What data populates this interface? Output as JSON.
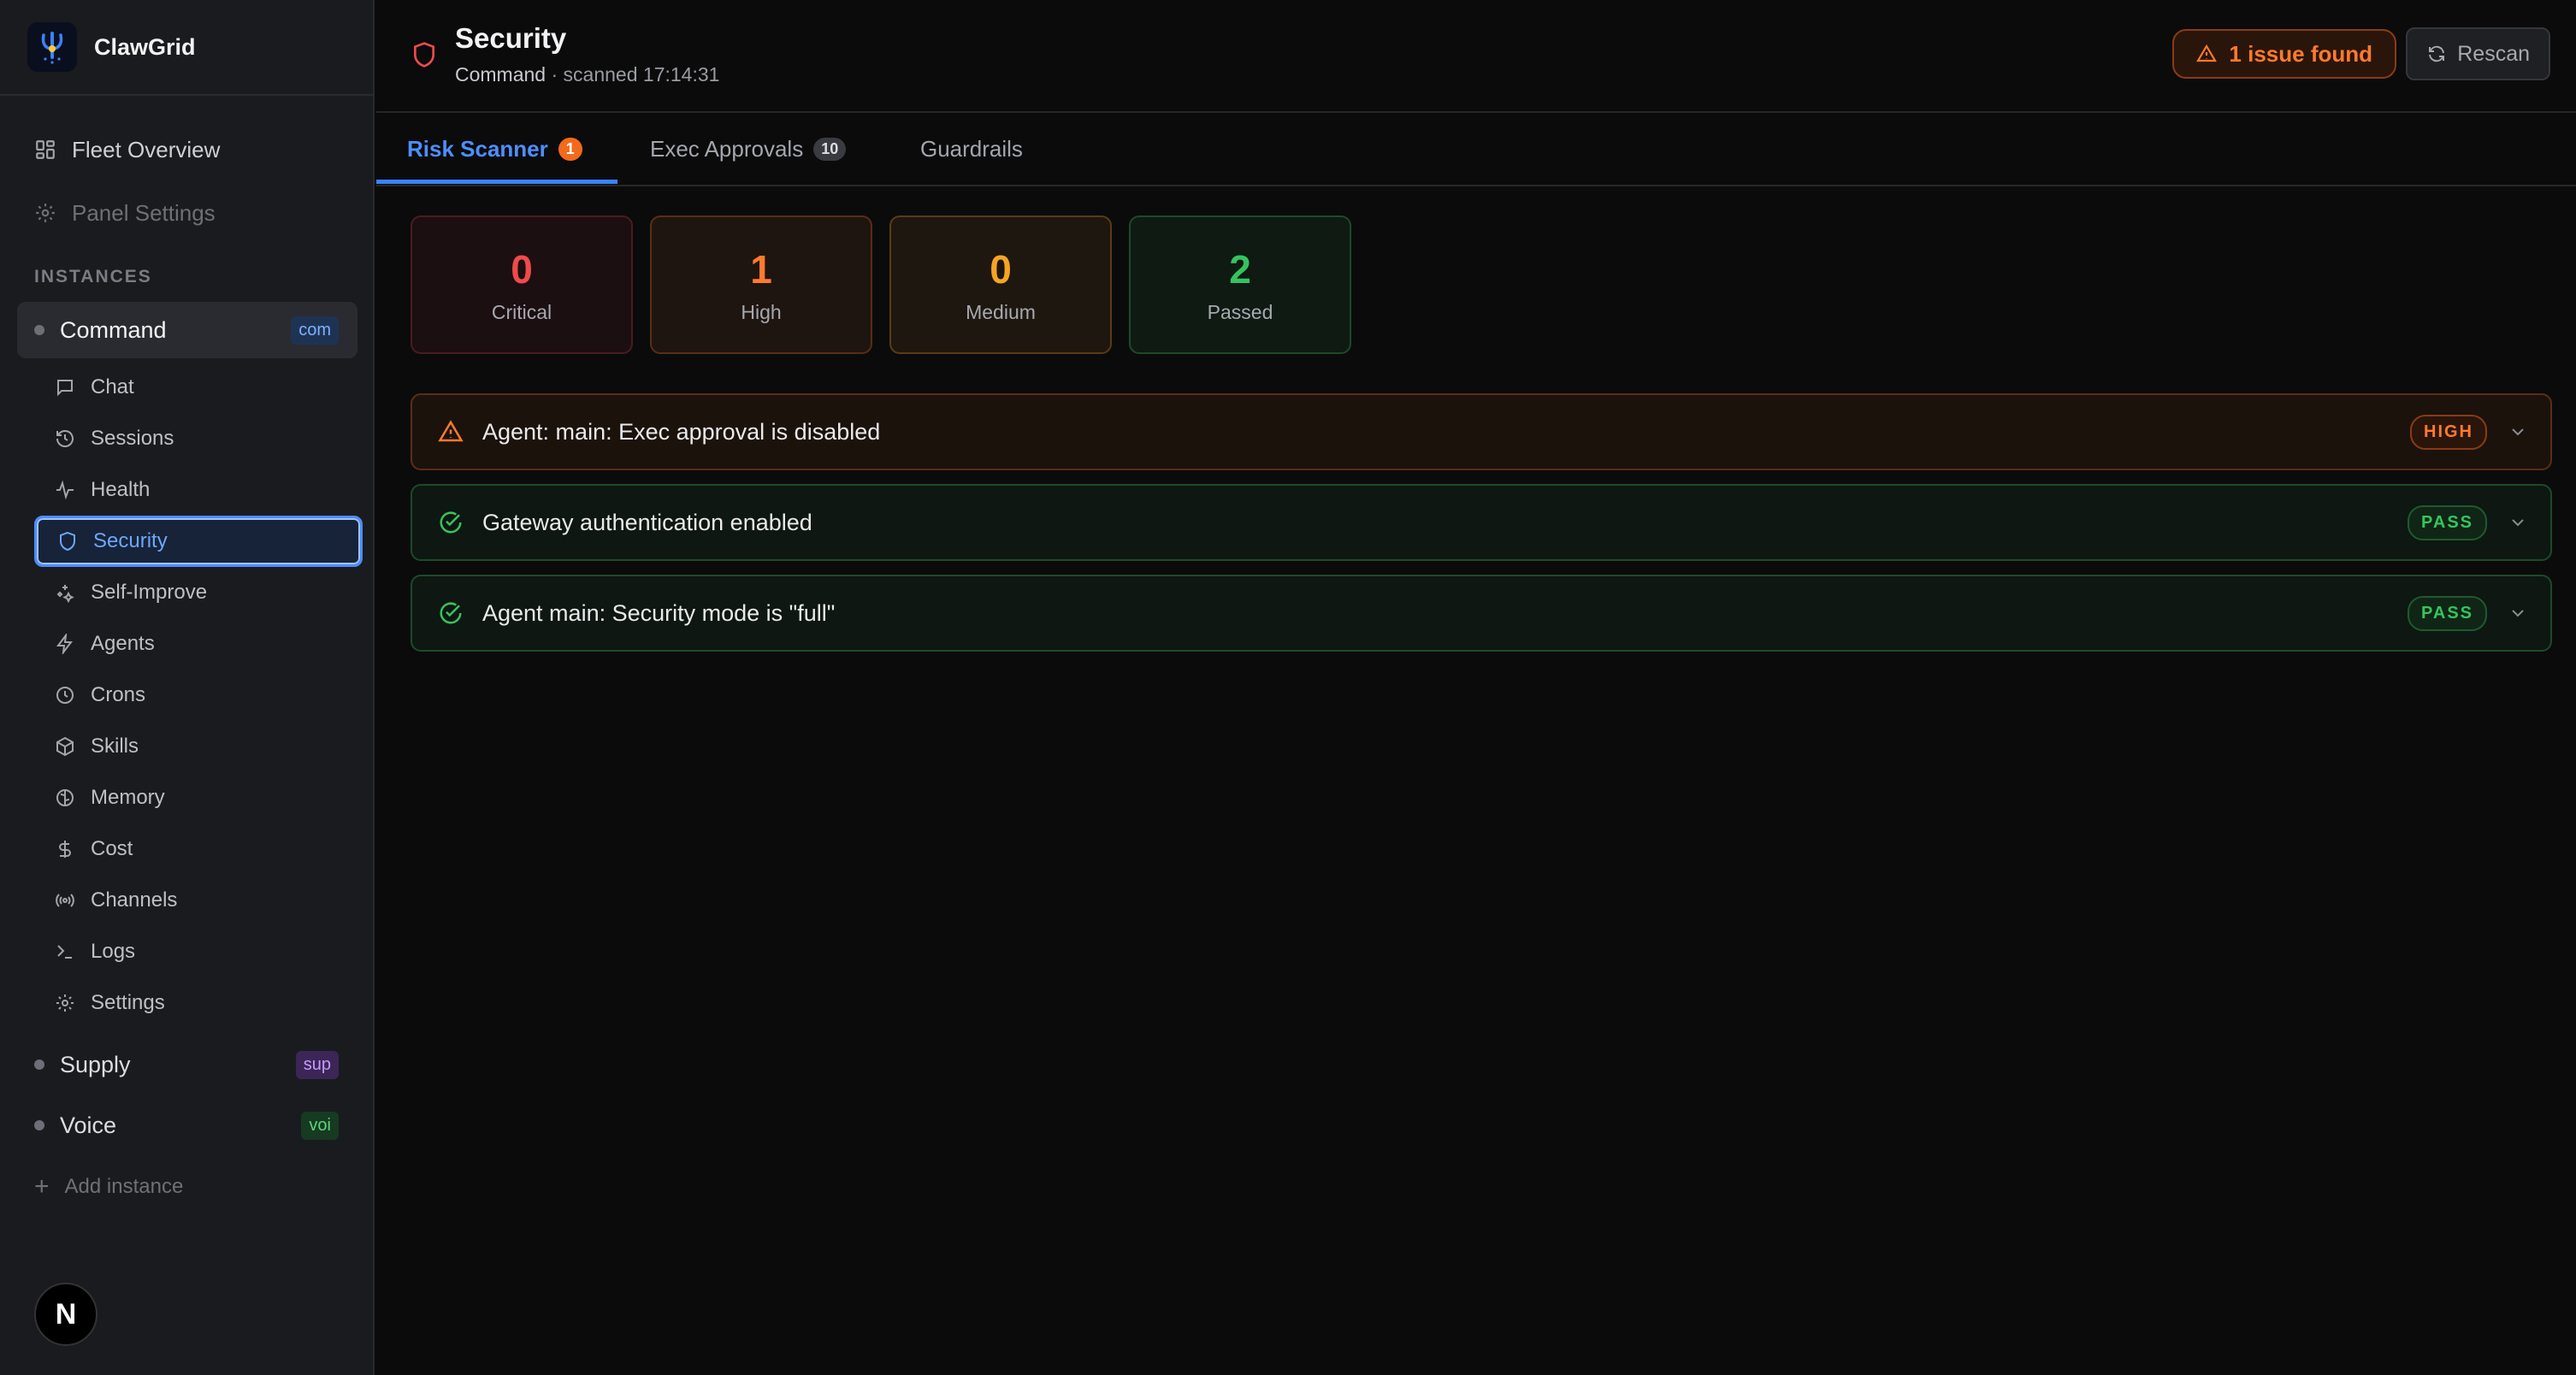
{
  "app": {
    "name": "ClawGrid"
  },
  "sidebar": {
    "top_nav": [
      {
        "label": "Fleet Overview",
        "icon": "grid-icon"
      },
      {
        "label": "Panel Settings",
        "icon": "gear-icon"
      }
    ],
    "section_label": "INSTANCES",
    "instances": [
      {
        "name": "Command",
        "tag": "com",
        "tag_color": "#7fb0ff",
        "tag_bg": "#1e3354",
        "active": true
      },
      {
        "name": "Supply",
        "tag": "sup",
        "tag_color": "#c79bff",
        "tag_bg": "#3b2657",
        "active": false
      },
      {
        "name": "Voice",
        "tag": "voi",
        "tag_color": "#5fd37a",
        "tag_bg": "#173a22",
        "active": false
      }
    ],
    "sub_nav": [
      {
        "label": "Chat",
        "icon": "chat-icon"
      },
      {
        "label": "Sessions",
        "icon": "history-icon"
      },
      {
        "label": "Health",
        "icon": "pulse-icon"
      },
      {
        "label": "Security",
        "icon": "shield-icon",
        "selected": true
      },
      {
        "label": "Self-Improve",
        "icon": "sparkles-icon"
      },
      {
        "label": "Agents",
        "icon": "bolt-icon"
      },
      {
        "label": "Crons",
        "icon": "clock-icon"
      },
      {
        "label": "Skills",
        "icon": "box-icon"
      },
      {
        "label": "Memory",
        "icon": "brain-icon"
      },
      {
        "label": "Cost",
        "icon": "dollar-icon"
      },
      {
        "label": "Channels",
        "icon": "radio-icon"
      },
      {
        "label": "Logs",
        "icon": "terminal-icon"
      },
      {
        "label": "Settings",
        "icon": "gear-icon"
      }
    ],
    "add_instance": "Add instance",
    "avatar_initial": "N"
  },
  "header": {
    "title": "Security",
    "instance": "Command",
    "scanned_text": "· scanned 17:14:31",
    "issue_button": "1 issue found",
    "rescan_button": "Rescan"
  },
  "tabs": [
    {
      "label": "Risk Scanner",
      "badge": "1",
      "active": true
    },
    {
      "label": "Exec Approvals",
      "badge": "10",
      "active": false
    },
    {
      "label": "Guardrails",
      "badge": "",
      "active": false
    }
  ],
  "stats": [
    {
      "value": "0",
      "label": "Critical",
      "color": "#f04a4a"
    },
    {
      "value": "1",
      "label": "High",
      "color": "#ff7a2e"
    },
    {
      "value": "0",
      "label": "Medium",
      "color": "#f5a524"
    },
    {
      "value": "2",
      "label": "Passed",
      "color": "#35c45e"
    }
  ],
  "findings": [
    {
      "title": "Agent: main: Exec approval is disabled",
      "status": "HIGH",
      "icon": "warning-icon"
    },
    {
      "title": "Gateway authentication enabled",
      "status": "PASS",
      "icon": "check-circle-icon"
    },
    {
      "title": "Agent main: Security mode is \"full\"",
      "status": "PASS",
      "icon": "check-circle-icon"
    }
  ]
}
